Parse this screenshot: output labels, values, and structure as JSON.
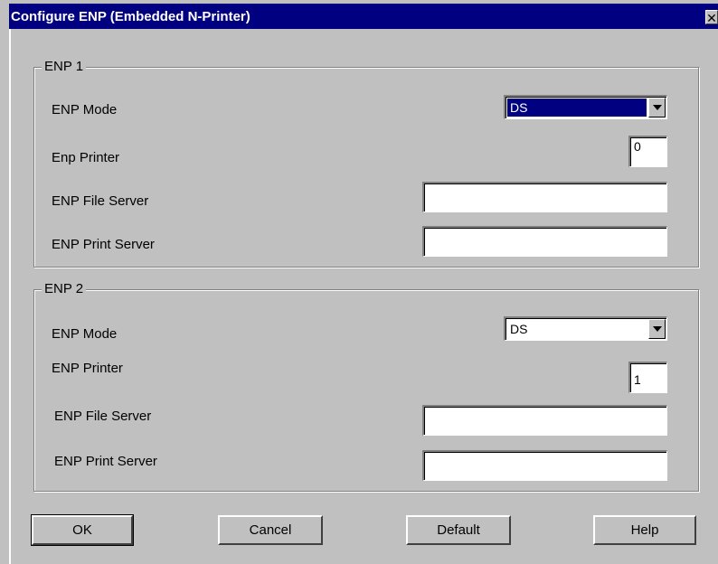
{
  "window": {
    "title": "Configure ENP (Embedded N-Printer)",
    "close_glyph": "✕"
  },
  "enp1": {
    "legend": "ENP 1",
    "mode_label": "ENP Mode",
    "mode_value": "DS",
    "printer_label": "Enp Printer",
    "printer_value": "0",
    "file_server_label": "ENP File Server",
    "file_server_value": "",
    "print_server_label": "ENP Print Server",
    "print_server_value": ""
  },
  "enp2": {
    "legend": "ENP 2",
    "mode_label": "ENP Mode",
    "mode_value": "DS",
    "printer_label": "ENP Printer",
    "printer_value": "1",
    "file_server_label": "ENP File Server",
    "file_server_value": "",
    "print_server_label": "ENP Print Server",
    "print_server_value": ""
  },
  "buttons": {
    "ok": "OK",
    "cancel": "Cancel",
    "default": "Default",
    "help": "Help"
  },
  "colors": {
    "titlebar": "#000080",
    "face": "#c0c0c0",
    "selection": "#000080"
  }
}
